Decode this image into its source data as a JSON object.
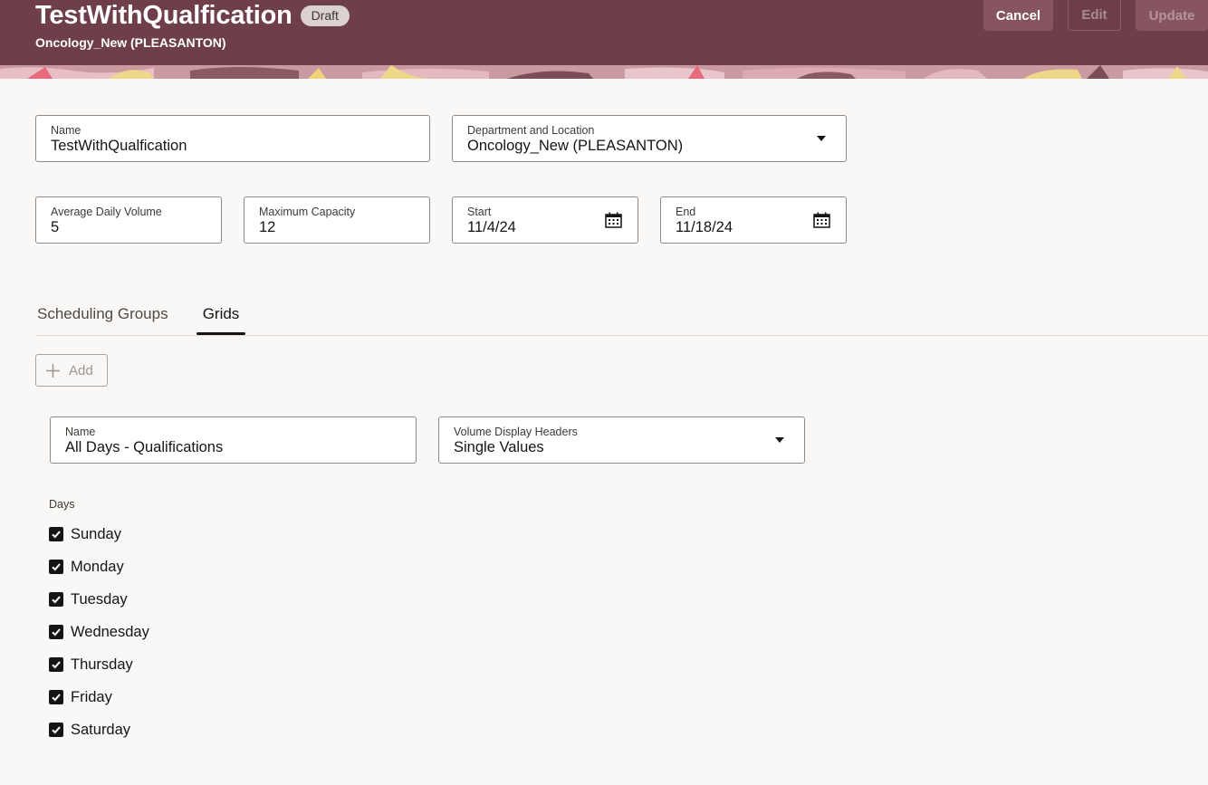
{
  "header": {
    "title": "TestWithQualfication",
    "status": "Draft",
    "subtitle": "Oncology_New (PLEASANTON)",
    "buttons": {
      "cancel": "Cancel",
      "edit": "Edit",
      "update": "Update"
    }
  },
  "form": {
    "name": {
      "label": "Name",
      "value": "TestWithQualfication"
    },
    "department": {
      "label": "Department and Location",
      "value": "Oncology_New (PLEASANTON)"
    },
    "avg_volume": {
      "label": "Average Daily Volume",
      "value": "5"
    },
    "max_capacity": {
      "label": "Maximum Capacity",
      "value": "12"
    },
    "start": {
      "label": "Start",
      "value": "11/4/24"
    },
    "end": {
      "label": "End",
      "value": "11/18/24"
    }
  },
  "tabs": [
    {
      "label": "Scheduling Groups",
      "selected": false
    },
    {
      "label": "Grids",
      "selected": true
    }
  ],
  "grids": {
    "add_label": "Add",
    "grid_name": {
      "label": "Name",
      "value": "All Days - Qualifications"
    },
    "volume_headers": {
      "label": "Volume Display Headers",
      "value": "Single Values"
    },
    "days_label": "Days",
    "days": [
      {
        "label": "Sunday",
        "checked": true
      },
      {
        "label": "Monday",
        "checked": true
      },
      {
        "label": "Tuesday",
        "checked": true
      },
      {
        "label": "Wednesday",
        "checked": true
      },
      {
        "label": "Thursday",
        "checked": true
      },
      {
        "label": "Friday",
        "checked": true
      },
      {
        "label": "Saturday",
        "checked": true
      }
    ]
  },
  "colors": {
    "header_bg": "#6e3f4a",
    "page_bg": "#f9f8f6",
    "text": "#161513"
  }
}
